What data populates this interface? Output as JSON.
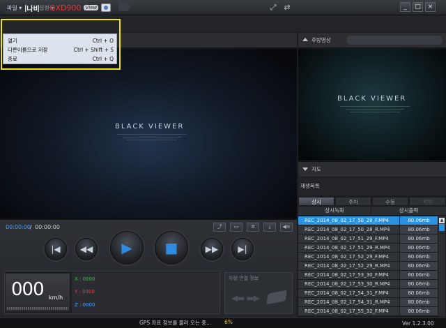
{
  "titlebar": {
    "brand": "아이나비",
    "model": "QXD900",
    "model_suffix": "View",
    "minimize": "_",
    "maximize": "□",
    "close": "×"
  },
  "menu": {
    "file": "파일 ▾",
    "settings": "설정 ▾"
  },
  "dropdown": {
    "items": [
      {
        "label": "열기",
        "shortcut": "Ctrl + O"
      },
      {
        "label": "다른이름으로 저장",
        "shortcut": "Ctrl + Shift + S"
      },
      {
        "label": "종료",
        "shortcut": "Ctrl + Q"
      }
    ]
  },
  "video": {
    "watermark": "BLACK VIEWER",
    "fullscreen_icon": "⤢",
    "swap_icon": "⇄"
  },
  "player": {
    "time_current": "00:00:00",
    "time_sep": "/",
    "time_total": "00:00:00"
  },
  "speed": {
    "value": "000",
    "unit": "km/h"
  },
  "gsensor": {
    "x": "X : 0000",
    "y": "Y : 0000",
    "z": "Z : 0000"
  },
  "vehicle": {
    "title": "차량 연결 정보"
  },
  "status": {
    "message": "GPS 좌표 정보를 불러 오는 중...",
    "percent": "6%",
    "version": "Ver 1.2.3.00"
  },
  "rear": {
    "title": "후방영상"
  },
  "map": {
    "title": "지도"
  },
  "playlist": {
    "title": "재생목록",
    "tabs": [
      "상시",
      "주차",
      "수동",
      "위치"
    ],
    "sub_headers": [
      "상시녹화",
      "상시출력"
    ],
    "files": [
      {
        "name": "REC_2014_08_02_17_50_28_F.MP4",
        "size": "80.06mb"
      },
      {
        "name": "REC_2014_08_02_17_50_28_R.MP4",
        "size": "80.06mb"
      },
      {
        "name": "REC_2014_08_02_17_51_29_F.MP4",
        "size": "80.06mb"
      },
      {
        "name": "REC_2014_08_02_17_51_29_R.MP4",
        "size": "80.06mb"
      },
      {
        "name": "REC_2014_08_02_17_52_29_F.MP4",
        "size": "80.06mb"
      },
      {
        "name": "REC_2014_08_02_17_52_29_R.MP4",
        "size": "80.06mb"
      },
      {
        "name": "REC_2014_08_02_17_53_30_F.MP4",
        "size": "80.06mb"
      },
      {
        "name": "REC_2014_08_02_17_53_30_R.MP4",
        "size": "80.06mb"
      },
      {
        "name": "REC_2014_08_02_17_54_31_F.MP4",
        "size": "80.06mb"
      },
      {
        "name": "REC_2014_08_02_17_54_31_R.MP4",
        "size": "80.06mb"
      },
      {
        "name": "REC_2014_08_02_17_55_32_F.MP4",
        "size": "80.06mb"
      }
    ]
  },
  "colors": {
    "accent_blue": "#2a92e0",
    "highlight_yellow": "#f5e400",
    "brand_red": "#e23a3a"
  }
}
